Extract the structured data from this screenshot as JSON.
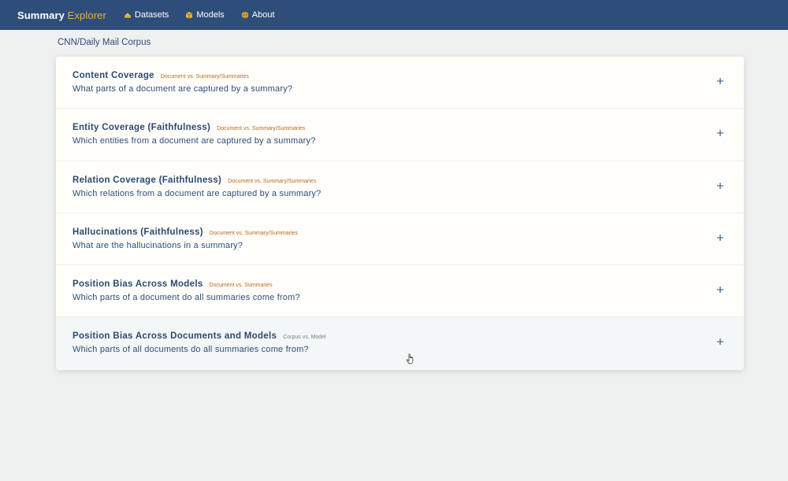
{
  "navbar": {
    "brand_main": "Summary",
    "brand_accent": "Explorer",
    "items": [
      {
        "label": "Datasets",
        "icon": "stack-icon"
      },
      {
        "label": "Models",
        "icon": "cube-icon"
      },
      {
        "label": "About",
        "icon": "globe-icon"
      }
    ],
    "colors": {
      "background": "#2e4d78",
      "accent": "#f0ad3c"
    }
  },
  "corpus": {
    "title": "CNN/Daily Mail Corpus"
  },
  "sections": [
    {
      "title": "Content Coverage",
      "tag": "Document vs. Summary/Summaries",
      "subtitle": "What parts of a document are captured by a summary?"
    },
    {
      "title": "Entity Coverage (Faithfulness)",
      "tag": "Document vs. Summary/Summaries",
      "subtitle": "Which entities from a document are captured by a summary?"
    },
    {
      "title": "Relation Coverage (Faithfulness)",
      "tag": "Document vs. Summary/Summaries",
      "subtitle": "Which relations from a document are captured by a summary?"
    },
    {
      "title": "Hallucinations (Faithfulness)",
      "tag": "Document vs. Summary/Summaries",
      "subtitle": "What are the hallucinations in a summary?"
    },
    {
      "title": "Position Bias Across Models",
      "tag": "Document vs. Summaries",
      "subtitle": "Which parts of a document do all summaries come from?"
    },
    {
      "title": "Position Bias Across Documents and Models",
      "tag": "Corpus vs. Model",
      "subtitle": "Which parts of all documents do all summaries come from?"
    }
  ]
}
